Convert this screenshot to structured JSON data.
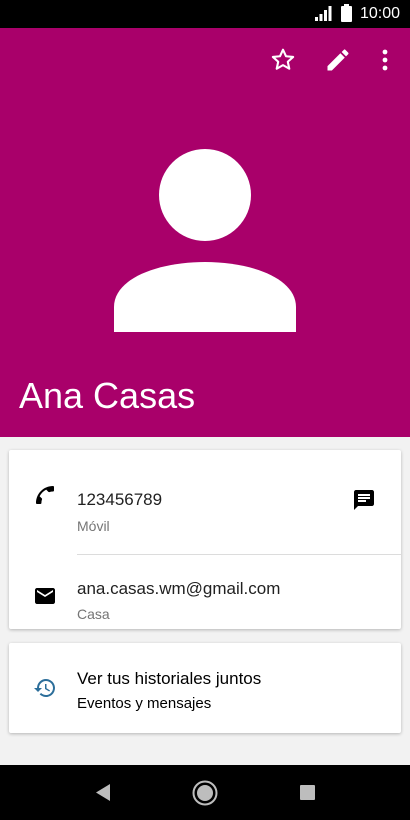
{
  "status_bar": {
    "time": "10:00",
    "icons": [
      "signal-icon",
      "battery-icon"
    ]
  },
  "theme": {
    "header_color": "#A9006A",
    "history_icon_color": "#2C6E9A"
  },
  "header": {
    "actions": [
      "star-icon",
      "edit-icon",
      "more-icon"
    ],
    "avatar": "person-icon",
    "name": "Ana Casas"
  },
  "details": {
    "phone": {
      "number": "123456789",
      "type": "Móvil",
      "icon": "phone-icon",
      "action_icon": "message-icon"
    },
    "email": {
      "address": "ana.casas.wm@gmail.com",
      "type": "Casa",
      "icon": "email-icon"
    }
  },
  "history": {
    "title": "Ver tus historiales juntos",
    "subtitle": "Eventos y mensajes",
    "icon": "history-icon"
  },
  "nav_bar": {
    "buttons": [
      "back-icon",
      "home-icon",
      "recents-icon"
    ]
  }
}
